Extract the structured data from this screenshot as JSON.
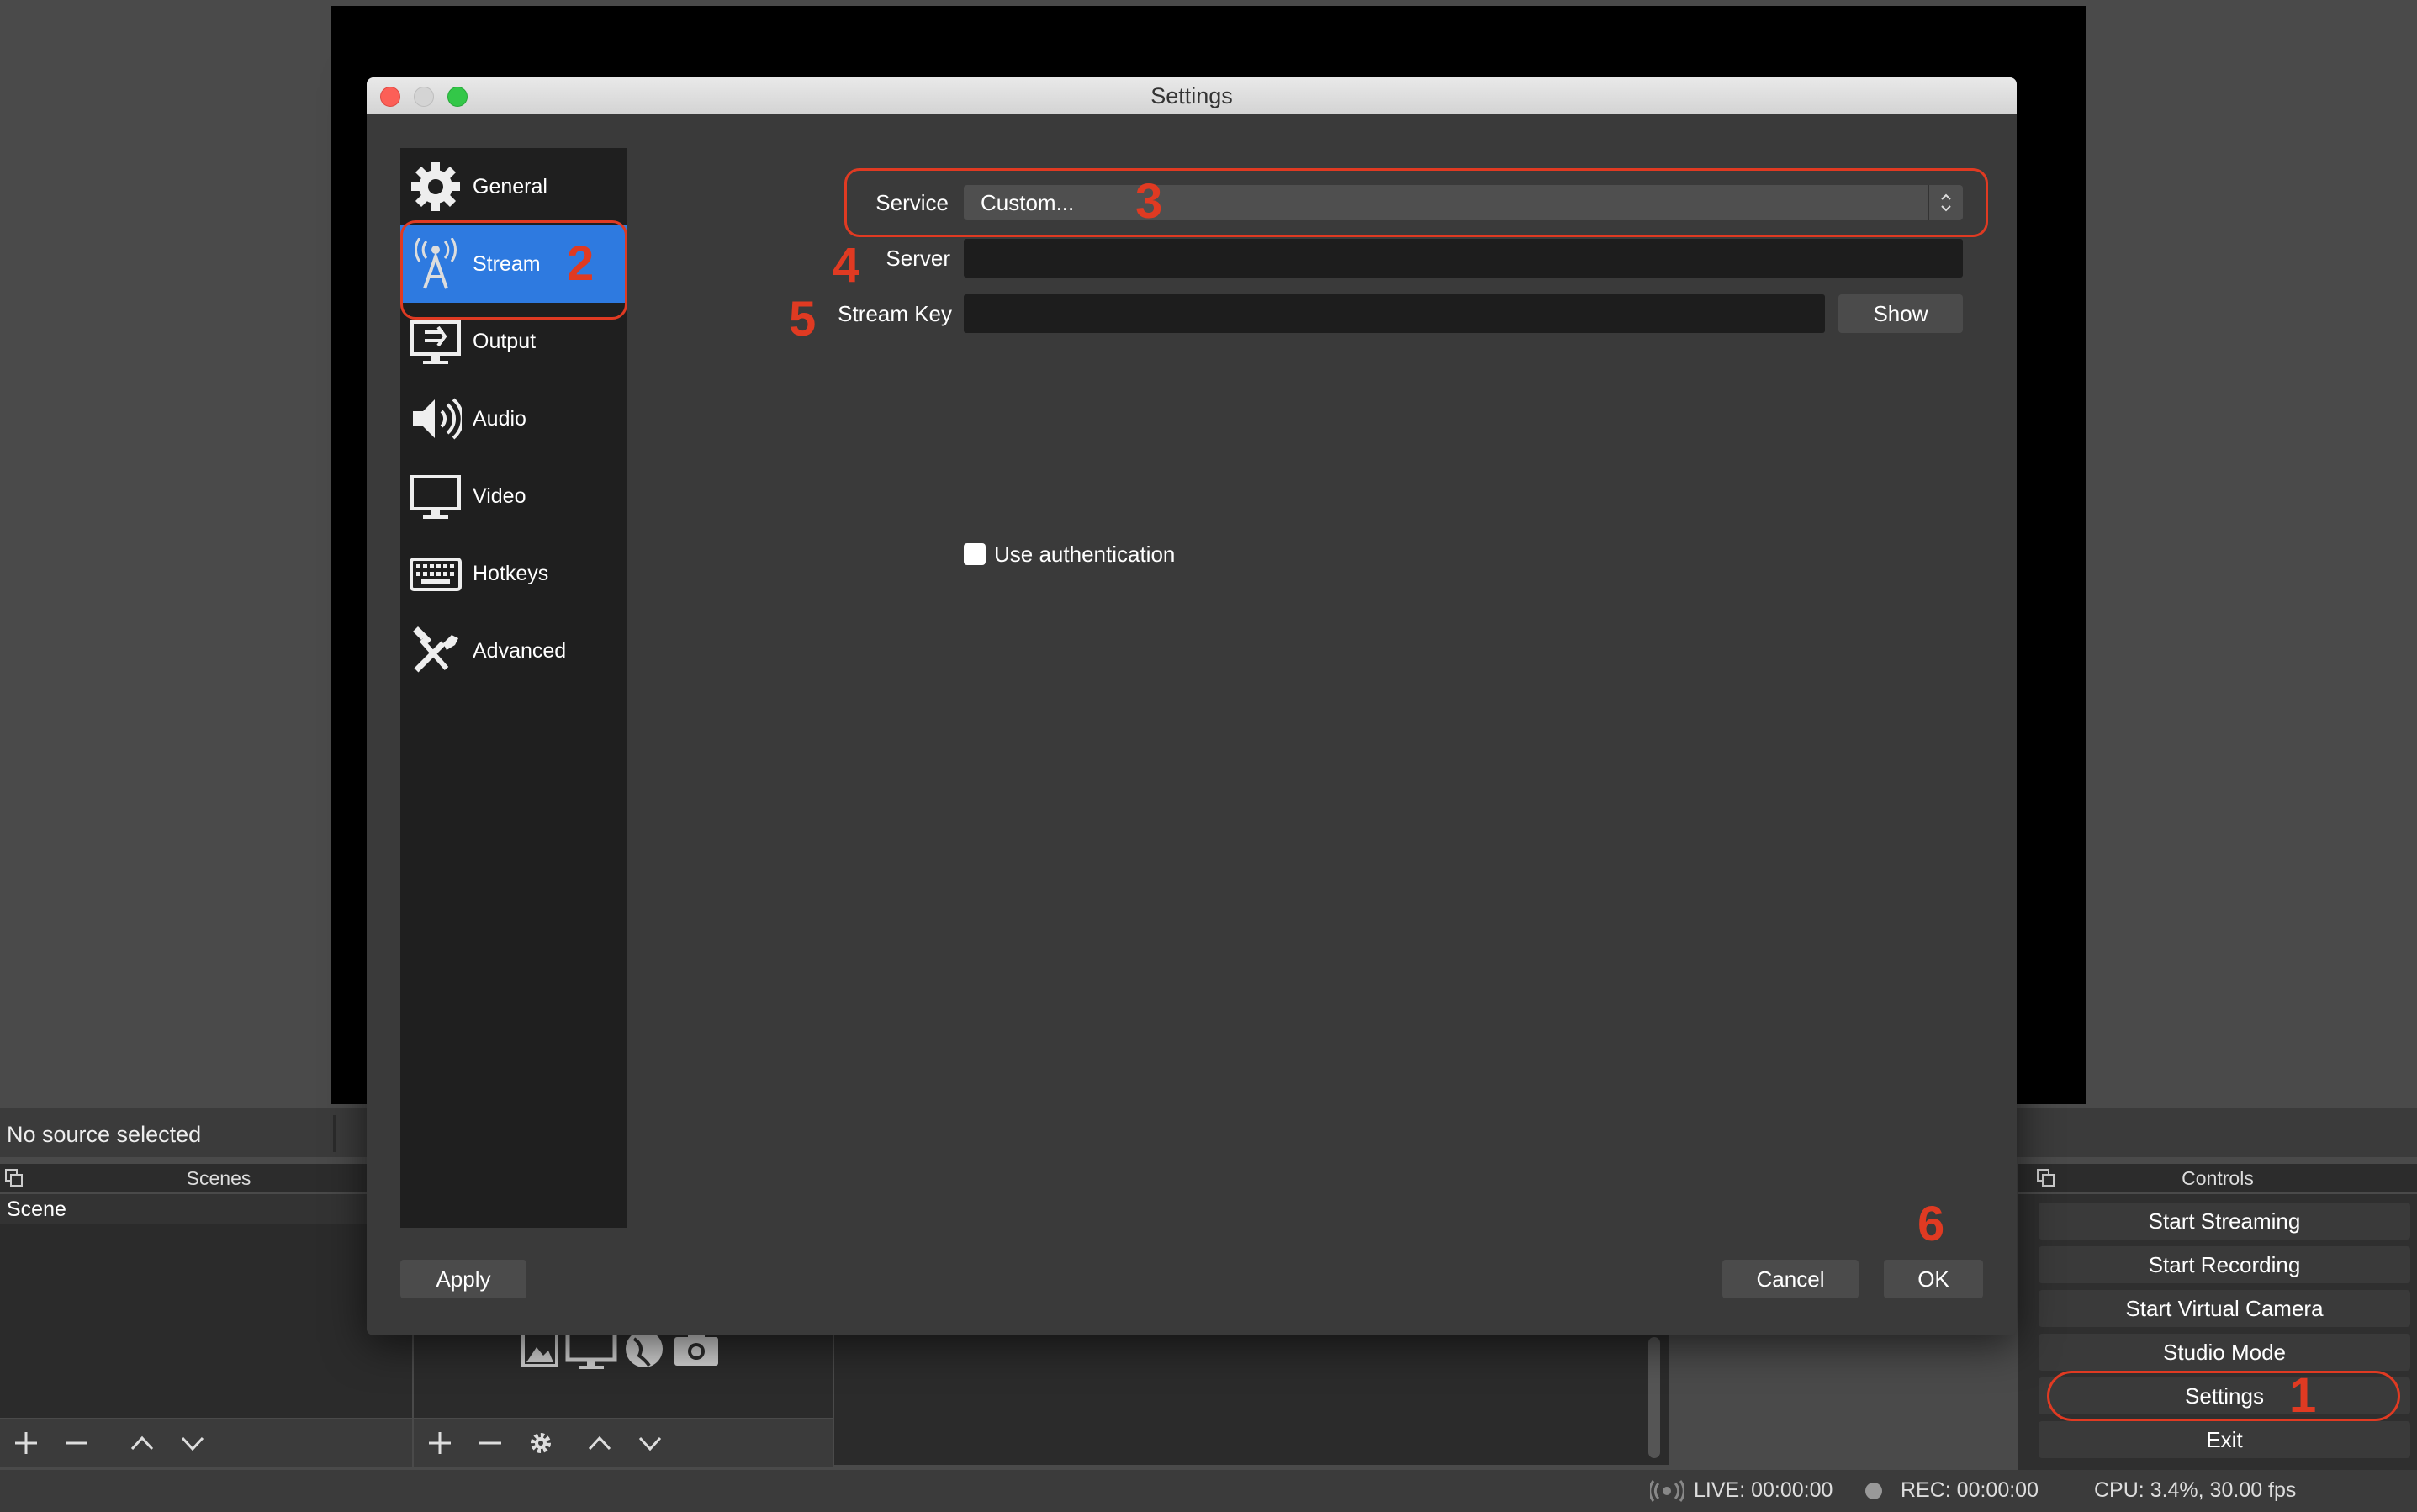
{
  "main": {
    "no_source": "No source selected",
    "scenes_title": "Scenes",
    "scene_item": "Scene",
    "controls_title": "Controls",
    "controls": [
      "Start Streaming",
      "Start Recording",
      "Start Virtual Camera",
      "Studio Mode",
      "Settings",
      "Exit"
    ],
    "status": {
      "live": "LIVE: 00:00:00",
      "rec": "REC: 00:00:00",
      "cpu": "CPU: 3.4%, 30.00 fps"
    }
  },
  "dialog": {
    "title": "Settings",
    "sidebar": [
      {
        "label": "General",
        "icon": "gear-icon"
      },
      {
        "label": "Stream",
        "icon": "antenna-icon",
        "active": true
      },
      {
        "label": "Output",
        "icon": "output-icon"
      },
      {
        "label": "Audio",
        "icon": "speaker-icon"
      },
      {
        "label": "Video",
        "icon": "monitor-icon"
      },
      {
        "label": "Hotkeys",
        "icon": "keyboard-icon"
      },
      {
        "label": "Advanced",
        "icon": "tools-icon"
      }
    ],
    "service_label": "Service",
    "service_value": "Custom...",
    "server_label": "Server",
    "server_value": "",
    "stream_key_label": "Stream Key",
    "stream_key_value": "",
    "show_button": "Show",
    "use_auth_label": "Use authentication",
    "use_auth_checked": false,
    "apply_button": "Apply",
    "cancel_button": "Cancel",
    "ok_button": "OK"
  },
  "annotations": [
    "1",
    "2",
    "3",
    "4",
    "5",
    "6"
  ],
  "colors": {
    "accent": "#2e7ae0",
    "annotation": "#e03a22",
    "window_bg": "#3a3a3a",
    "sidebar_bg": "#1f1f1f"
  }
}
